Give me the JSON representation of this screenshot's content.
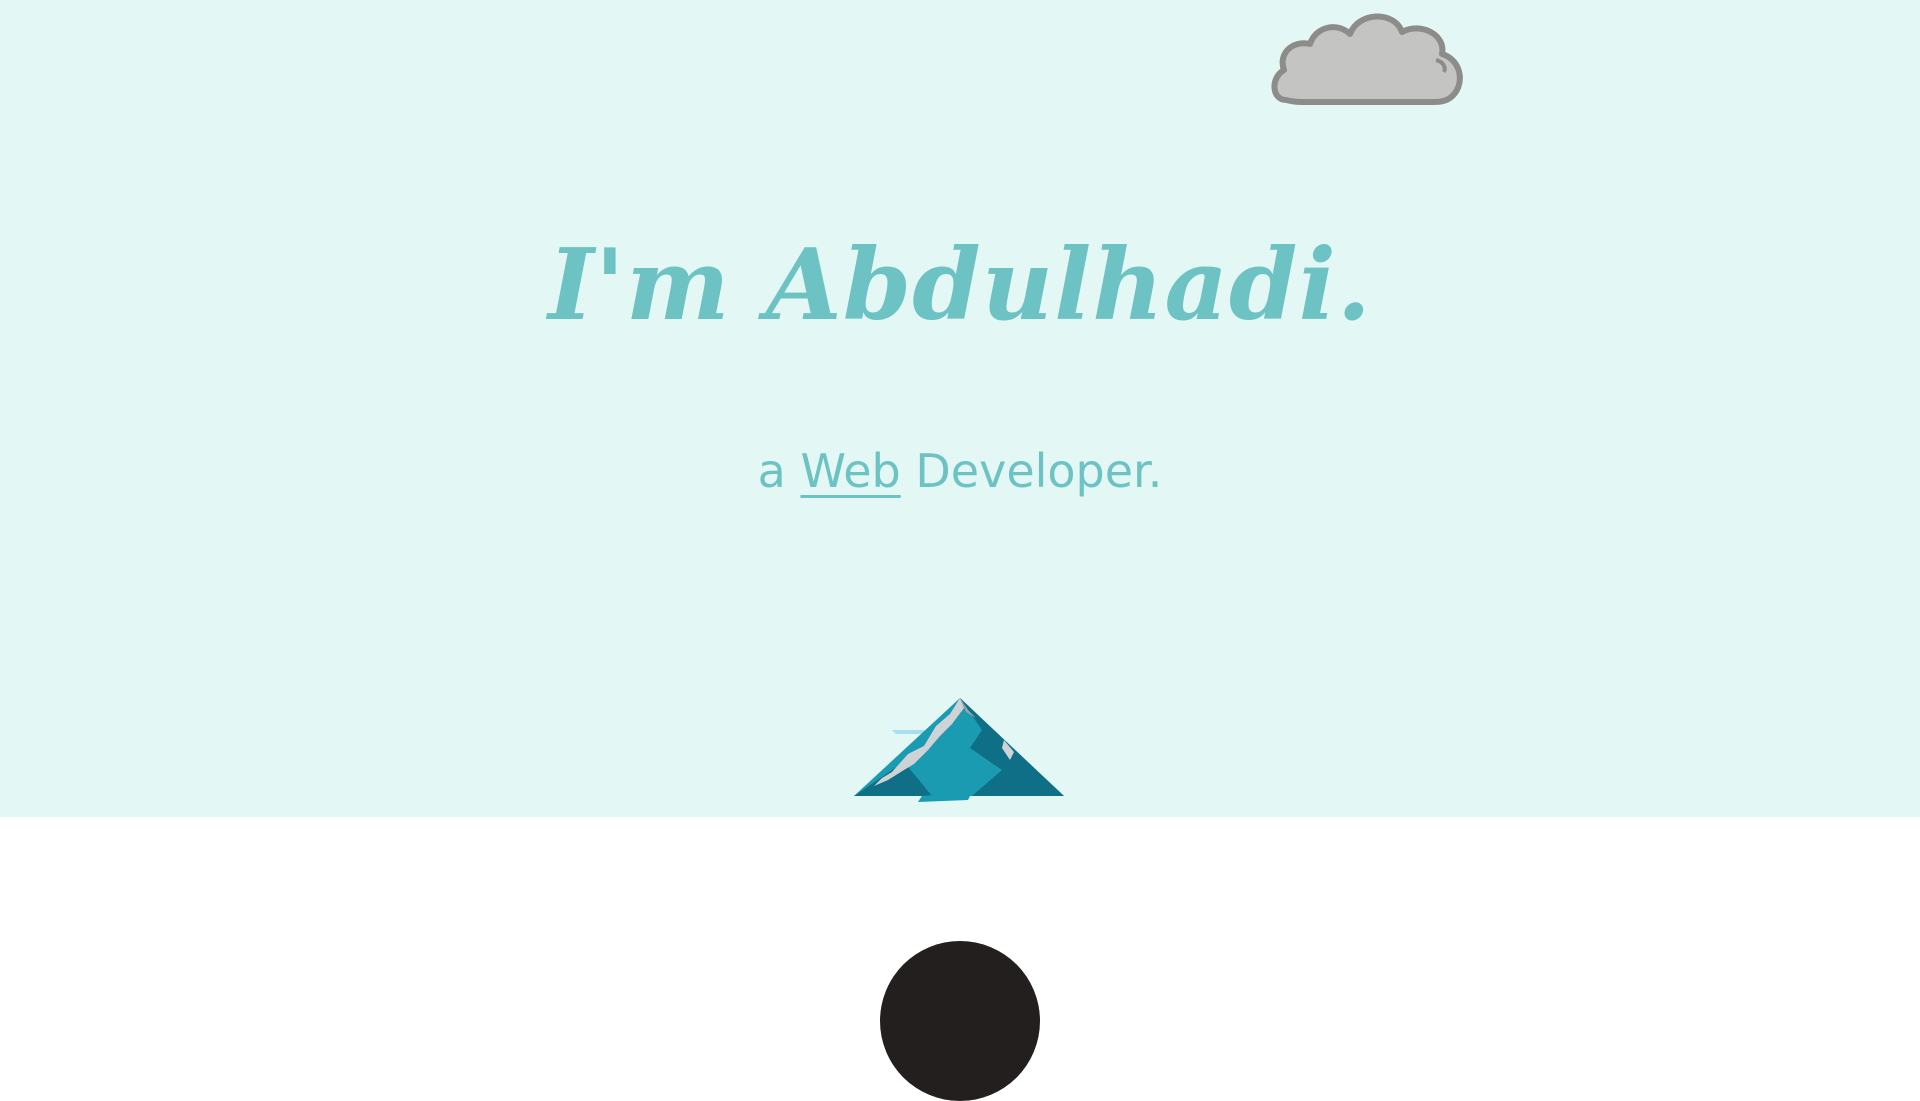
{
  "hero": {
    "background_color": "#e3f7f4",
    "accent_color": "#6dc3c3",
    "title": "I'm Abdulhadi.",
    "subtitle_prefix": "a",
    "subtitle_highlight": "Web",
    "subtitle_suffix": "Developer."
  },
  "decorations": {
    "cloud": "cloud-icon",
    "mountain": "mountain-icon"
  },
  "profile": {
    "avatar": "avatar"
  }
}
